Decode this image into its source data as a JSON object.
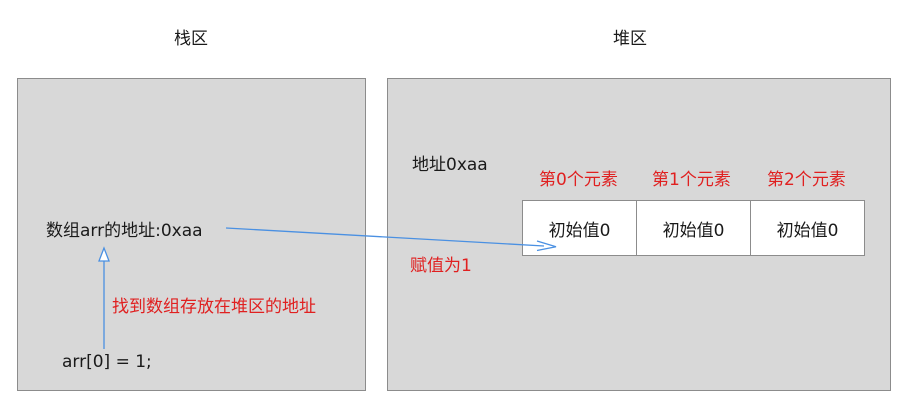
{
  "stack": {
    "title": "栈区",
    "array_var": "数组arr的地址:0xaa",
    "statement": "arr[0] = 1;",
    "annotation": "找到数组存放在堆区的地址"
  },
  "heap": {
    "title": "堆区",
    "address": "地址0xaa",
    "assign_label": "赋值为1",
    "elements": [
      {
        "label": "第0个元素",
        "value": "初始值0"
      },
      {
        "label": "第1个元素",
        "value": "初始值0"
      },
      {
        "label": "第2个元素",
        "value": "初始值0"
      }
    ]
  },
  "colors": {
    "arrow": "#4a90e2",
    "annotation": "#e02020",
    "region_fill": "#d8d8d8",
    "region_border": "#8c8c8c"
  }
}
